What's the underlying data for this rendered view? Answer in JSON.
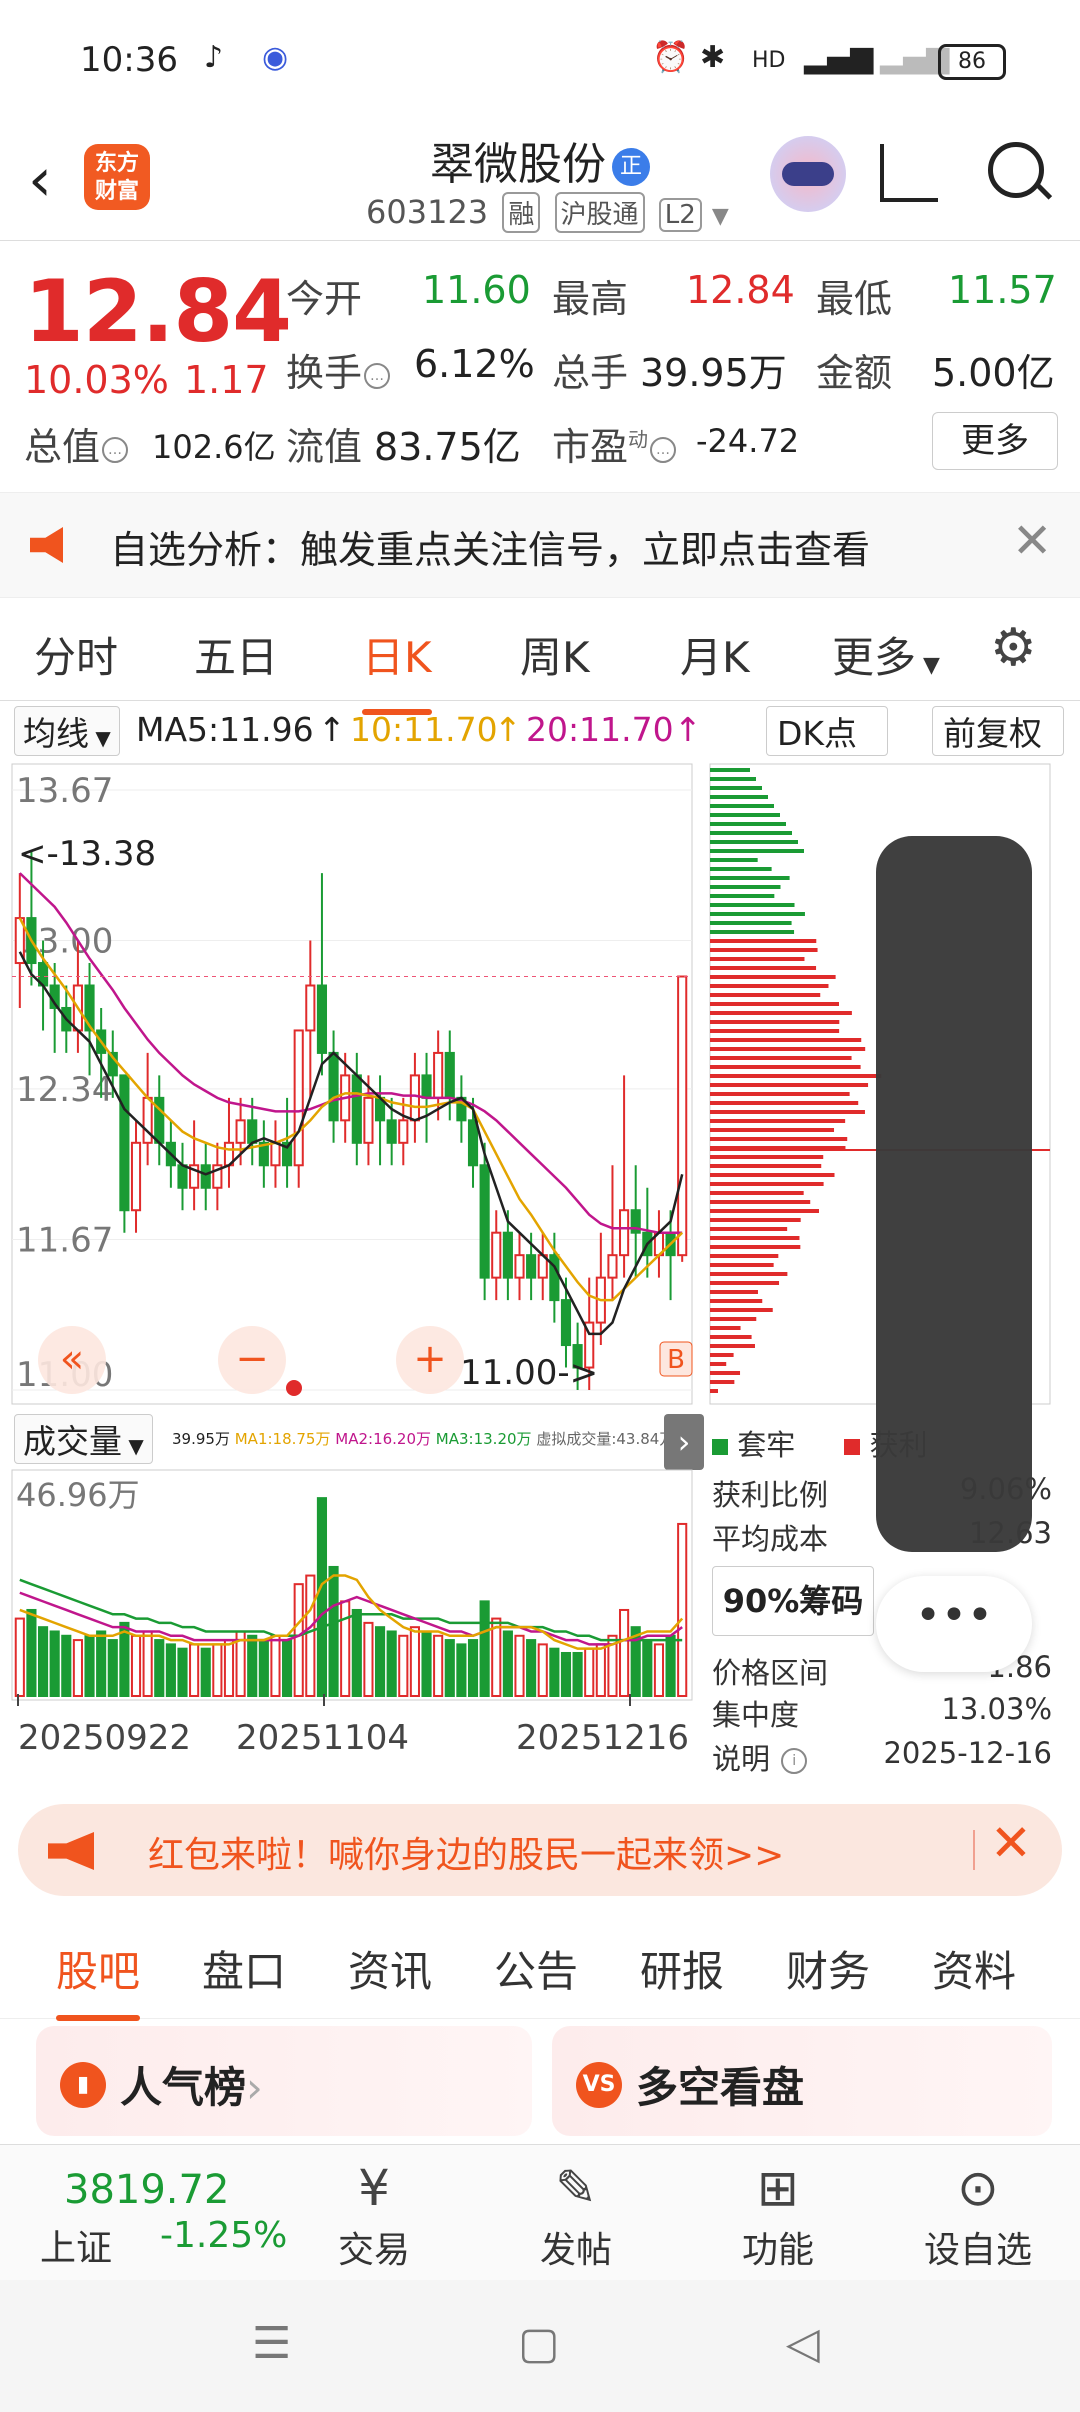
{
  "status": {
    "time": "10:36",
    "battery": "86"
  },
  "header": {
    "logo_line1": "东方",
    "logo_line2": "财富",
    "stock_name": "翠微股份",
    "name_badge": "正",
    "code": "603123",
    "tags": [
      "融",
      "沪股通",
      "L2"
    ]
  },
  "quote": {
    "price": "12.84",
    "change_pct": "10.03%",
    "change": "1.17",
    "fields": [
      {
        "label": "今开",
        "value": "11.60"
      },
      {
        "label": "最高",
        "value": "12.84"
      },
      {
        "label": "最低",
        "value": "11.57"
      },
      {
        "label": "换手",
        "value": "6.12%"
      },
      {
        "label": "总手",
        "value": "39.95万"
      },
      {
        "label": "金额",
        "value": "5.00亿"
      },
      {
        "label": "总值",
        "value": "102.6亿"
      },
      {
        "label": "流值",
        "value": "83.75亿"
      },
      {
        "label": "市盈",
        "value": "-24.72",
        "sup": "动"
      }
    ],
    "more_label": "更多"
  },
  "alert": {
    "text": "自选分析：触发重点关注信号，立即点击查看"
  },
  "periods": [
    "分时",
    "五日",
    "日K",
    "周K",
    "月K",
    "更多"
  ],
  "active_period": "日K",
  "ma_row": {
    "selector": "均线",
    "ma5": "MA5:11.96",
    "ma10": "10:11.70",
    "ma20": "20:11.70",
    "dk": "DK点",
    "adjust": "前复权"
  },
  "chart_data": {
    "type": "candlestick",
    "price_ticks": [
      "13.67",
      "13.00",
      "12.34",
      "11.67",
      "11.00"
    ],
    "ylim": [
      11.0,
      13.67
    ],
    "annotation_high": "<-13.38",
    "annotation_low": "11.00->",
    "dates": [
      "20250922",
      "20251104",
      "20251216"
    ],
    "candles": [
      [
        12.9,
        13.1,
        12.7,
        13.3
      ],
      [
        13.1,
        12.9,
        12.8,
        13.4
      ],
      [
        12.9,
        12.8,
        12.6,
        13.0
      ],
      [
        12.8,
        12.7,
        12.5,
        12.9
      ],
      [
        12.7,
        12.6,
        12.5,
        12.8
      ],
      [
        12.6,
        12.8,
        12.5,
        13.0
      ],
      [
        12.8,
        12.6,
        12.4,
        12.9
      ],
      [
        12.6,
        12.5,
        12.3,
        12.7
      ],
      [
        12.5,
        12.4,
        12.3,
        12.6
      ],
      [
        12.4,
        11.8,
        11.7,
        12.4
      ],
      [
        11.8,
        12.1,
        11.7,
        12.2
      ],
      [
        12.1,
        12.3,
        12.0,
        12.5
      ],
      [
        12.3,
        12.1,
        12.0,
        12.4
      ],
      [
        12.1,
        12.0,
        11.9,
        12.2
      ],
      [
        12.0,
        11.9,
        11.8,
        12.1
      ],
      [
        11.9,
        12.0,
        11.8,
        12.2
      ],
      [
        12.0,
        11.9,
        11.8,
        12.1
      ],
      [
        11.9,
        12.0,
        11.8,
        12.1
      ],
      [
        12.0,
        12.1,
        11.9,
        12.3
      ],
      [
        12.1,
        12.2,
        12.0,
        12.3
      ],
      [
        12.2,
        12.1,
        12.0,
        12.3
      ],
      [
        12.1,
        12.0,
        11.9,
        12.2
      ],
      [
        12.0,
        12.1,
        11.9,
        12.2
      ],
      [
        12.1,
        12.0,
        11.9,
        12.3
      ],
      [
        12.0,
        12.6,
        11.9,
        12.6
      ],
      [
        12.6,
        12.8,
        12.3,
        13.0
      ],
      [
        12.8,
        12.5,
        12.4,
        13.3
      ],
      [
        12.5,
        12.2,
        12.1,
        12.6
      ],
      [
        12.2,
        12.4,
        12.1,
        12.5
      ],
      [
        12.4,
        12.1,
        12.0,
        12.5
      ],
      [
        12.1,
        12.3,
        12.0,
        12.4
      ],
      [
        12.3,
        12.2,
        12.0,
        12.4
      ],
      [
        12.2,
        12.1,
        12.0,
        12.3
      ],
      [
        12.1,
        12.2,
        12.0,
        12.3
      ],
      [
        12.2,
        12.4,
        12.1,
        12.5
      ],
      [
        12.4,
        12.3,
        12.1,
        12.5
      ],
      [
        12.3,
        12.5,
        12.2,
        12.6
      ],
      [
        12.5,
        12.3,
        12.2,
        12.6
      ],
      [
        12.3,
        12.2,
        12.1,
        12.4
      ],
      [
        12.2,
        12.0,
        11.9,
        12.3
      ],
      [
        12.0,
        11.5,
        11.4,
        12.1
      ],
      [
        11.5,
        11.7,
        11.4,
        11.8
      ],
      [
        11.7,
        11.5,
        11.4,
        11.8
      ],
      [
        11.5,
        11.6,
        11.4,
        11.7
      ],
      [
        11.6,
        11.5,
        11.4,
        11.7
      ],
      [
        11.5,
        11.6,
        11.4,
        11.7
      ],
      [
        11.6,
        11.4,
        11.3,
        11.7
      ],
      [
        11.4,
        11.2,
        11.1,
        11.5
      ],
      [
        11.2,
        11.1,
        11.0,
        11.3
      ],
      [
        11.1,
        11.3,
        11.0,
        11.5
      ],
      [
        11.3,
        11.5,
        11.2,
        11.7
      ],
      [
        11.5,
        11.6,
        11.4,
        12.0
      ],
      [
        11.6,
        11.8,
        11.5,
        12.4
      ],
      [
        11.8,
        11.7,
        11.5,
        12.0
      ],
      [
        11.7,
        11.6,
        11.5,
        11.9
      ],
      [
        11.6,
        11.7,
        11.5,
        11.8
      ],
      [
        11.7,
        11.6,
        11.4,
        11.8
      ],
      [
        11.6,
        12.84,
        11.57,
        12.84
      ]
    ],
    "ma5": [
      12.95,
      12.85,
      12.8,
      12.72,
      12.65,
      12.6,
      12.55,
      12.45,
      12.35,
      12.25,
      12.2,
      12.15,
      12.1,
      12.05,
      12.0,
      11.98,
      11.96,
      11.98,
      12.0,
      12.05,
      12.1,
      12.12,
      12.1,
      12.08,
      12.15,
      12.3,
      12.45,
      12.5,
      12.45,
      12.4,
      12.35,
      12.3,
      12.25,
      12.22,
      12.2,
      12.22,
      12.25,
      12.28,
      12.3,
      12.25,
      12.05,
      11.9,
      11.75,
      11.7,
      11.65,
      11.6,
      11.55,
      11.45,
      11.35,
      11.25,
      11.25,
      11.3,
      11.45,
      11.55,
      11.65,
      11.7,
      11.75,
      11.96
    ],
    "ma10": [
      13.1,
      13.0,
      12.92,
      12.85,
      12.78,
      12.7,
      12.62,
      12.55,
      12.48,
      12.42,
      12.36,
      12.3,
      12.25,
      12.2,
      12.15,
      12.12,
      12.1,
      12.08,
      12.07,
      12.07,
      12.08,
      12.09,
      12.1,
      12.12,
      12.15,
      12.2,
      12.26,
      12.3,
      12.32,
      12.32,
      12.31,
      12.3,
      12.28,
      12.27,
      12.26,
      12.26,
      12.27,
      12.28,
      12.28,
      12.25,
      12.15,
      12.05,
      11.95,
      11.85,
      11.78,
      11.7,
      11.62,
      11.55,
      11.48,
      11.42,
      11.4,
      11.4,
      11.45,
      11.5,
      11.55,
      11.6,
      11.65,
      11.7
    ],
    "ma20": [
      13.3,
      13.25,
      13.2,
      13.15,
      13.08,
      13.0,
      12.92,
      12.85,
      12.78,
      12.7,
      12.63,
      12.56,
      12.5,
      12.45,
      12.4,
      12.36,
      12.33,
      12.3,
      12.28,
      12.27,
      12.26,
      12.25,
      12.24,
      12.24,
      12.24,
      12.25,
      12.27,
      12.29,
      12.3,
      12.31,
      12.32,
      12.32,
      12.32,
      12.31,
      12.31,
      12.3,
      12.3,
      12.3,
      12.29,
      12.27,
      12.24,
      12.2,
      12.15,
      12.1,
      12.05,
      12.0,
      11.95,
      11.9,
      11.84,
      11.78,
      11.74,
      11.72,
      11.72,
      11.72,
      11.71,
      11.7,
      11.7,
      11.7
    ],
    "volume_max_label": "46.96万",
    "volume": [
      18,
      20,
      16,
      15,
      14,
      13,
      14,
      15,
      13,
      17,
      14,
      15,
      13,
      12,
      11,
      12,
      11,
      12,
      13,
      15,
      14,
      13,
      14,
      13,
      26,
      28,
      46,
      30,
      22,
      20,
      17,
      16,
      15,
      14,
      16,
      15,
      14,
      13,
      12,
      13,
      22,
      18,
      15,
      14,
      13,
      12,
      11,
      10,
      10,
      11,
      12,
      14,
      20,
      16,
      13,
      12,
      14,
      40
    ],
    "vol_ma1": [
      20,
      19,
      18,
      17,
      16,
      15,
      14,
      14,
      14,
      15,
      14,
      14,
      14,
      13,
      13,
      12,
      12,
      12,
      12,
      13,
      13,
      13,
      14,
      14,
      17,
      20,
      26,
      28,
      28,
      27,
      23,
      20,
      18,
      16,
      15,
      15,
      15,
      14,
      14,
      14,
      15,
      16,
      16,
      16,
      16,
      15,
      13,
      12,
      11,
      11,
      11,
      12,
      13,
      14,
      15,
      15,
      15,
      18
    ],
    "vol_ma2": [
      24,
      23,
      22,
      21,
      20,
      19,
      18,
      17,
      16,
      16,
      15,
      15,
      15,
      14,
      14,
      13,
      13,
      13,
      13,
      13,
      13,
      13,
      13,
      13,
      14,
      16,
      19,
      21,
      22,
      23,
      22,
      21,
      20,
      19,
      18,
      17,
      16,
      15,
      15,
      14,
      15,
      16,
      16,
      16,
      15,
      15,
      14,
      13,
      13,
      12,
      12,
      12,
      13,
      13,
      14,
      14,
      14,
      16
    ],
    "vol_ma3": [
      27,
      26,
      25,
      24,
      23,
      22,
      21,
      20,
      19,
      19,
      18,
      18,
      17,
      17,
      16,
      16,
      15,
      15,
      15,
      15,
      15,
      15,
      14,
      14,
      14,
      15,
      16,
      17,
      18,
      19,
      19,
      19,
      19,
      18,
      18,
      18,
      18,
      17,
      17,
      17,
      17,
      17,
      17,
      16,
      16,
      16,
      15,
      15,
      14,
      14,
      13,
      13,
      13,
      13,
      13,
      13,
      13,
      13
    ]
  },
  "volume_header": {
    "selector": "成交量",
    "mini": [
      "39.95万",
      "MA1:18.75万",
      "MA2:16.20万",
      "MA3:13.20万",
      "虚拟成交量:43.84万"
    ]
  },
  "chips": {
    "legend_trapped": "套牢",
    "legend_profit": "获利",
    "profit_ratio_label": "获利比例",
    "profit_ratio_value": "9.06%",
    "avg_cost_label": "平均成本",
    "avg_cost_value": "12.63",
    "box_label": "90%筹码",
    "price_range_label": "价格区间",
    "price_range_value": "1.86",
    "concentration_label": "集中度",
    "concentration_value": "13.03%",
    "note_label": "说明",
    "note_value": "2025-12-16",
    "menu_dots": "•••"
  },
  "packet": {
    "text": "红包来啦！喊你身边的股民一起来领>>"
  },
  "subtabs": [
    "股吧",
    "盘口",
    "资讯",
    "公告",
    "研报",
    "财务",
    "资料"
  ],
  "cards": [
    {
      "title": "人气榜",
      "arrow": "›"
    },
    {
      "title": "多空看盘"
    }
  ],
  "bottomnav": {
    "index_value": "3819.72",
    "index_name": "上证",
    "index_pct": "-1.25%",
    "items": [
      "交易",
      "发帖",
      "功能",
      "设自选"
    ]
  },
  "colors": {
    "red": "#e02b2b",
    "green": "#1a9b34",
    "orange": "#f0541e"
  }
}
